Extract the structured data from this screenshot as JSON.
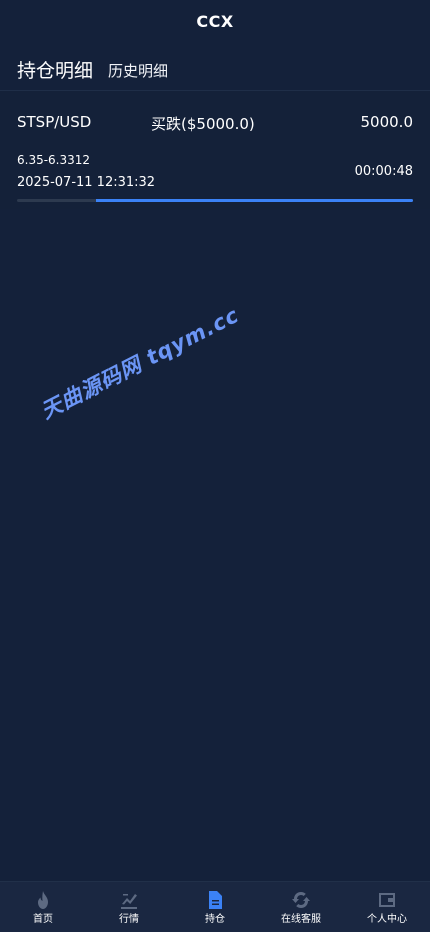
{
  "header": {
    "title": "CCX"
  },
  "tabs": {
    "active": "持仓明细",
    "inactive": "历史明细"
  },
  "position": {
    "symbol": "STSP/USD",
    "direction": "买跌($5000.0)",
    "amount": "5000.0",
    "price_range": "6.35-6.3312",
    "open_time": "2025-07-11 12:31:32",
    "countdown": "00:00:48",
    "progress_remaining_fraction": 0.8
  },
  "watermark": {
    "text": "天曲源码网 tqym.cc"
  },
  "colors": {
    "background": "#14213a",
    "accent": "#3b82f6",
    "active_nav": "#3b82f6",
    "inactive_nav_icon": "#5d6a82"
  },
  "bottom_nav": {
    "items": [
      {
        "label": "首页",
        "icon": "flame-icon",
        "active": false
      },
      {
        "label": "行情",
        "icon": "chart-pen-icon",
        "active": false
      },
      {
        "label": "持仓",
        "icon": "document-icon",
        "active": true
      },
      {
        "label": "在线客服",
        "icon": "refresh-icon",
        "active": false
      },
      {
        "label": "个人中心",
        "icon": "wallet-icon",
        "active": false
      }
    ]
  }
}
